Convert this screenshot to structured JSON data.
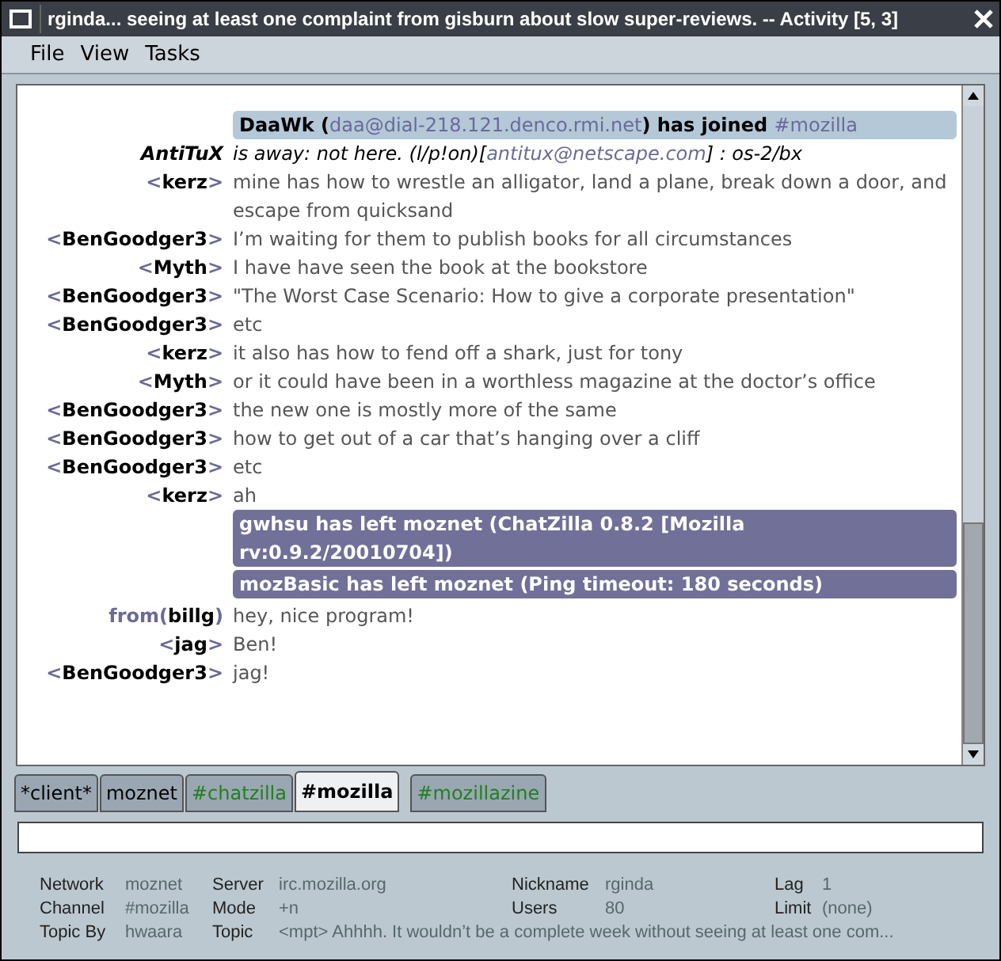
{
  "window": {
    "title": "rginda... seeing at least one complaint from gisburn about slow super-reviews. -- Activity [5, 3]"
  },
  "menu": [
    "File",
    "View",
    "Tasks"
  ],
  "messages": [
    {
      "kind": "join",
      "before": "DaaWk (",
      "host": "daa@dial-218.121.denco.rmi.net",
      "after": ") has joined ",
      "channel": "#mozilla"
    },
    {
      "kind": "away",
      "nick": "AntiTuX",
      "before": "is away: not here. (l/p!on)[",
      "email": "antitux@netscape.com",
      "after": "] : os-2/bx"
    },
    {
      "kind": "msg",
      "open": "<",
      "nick": "kerz",
      "close": ">",
      "text": "mine has how to wrestle an alligator, land a plane, break down a door, and escape from quicksand"
    },
    {
      "kind": "msg",
      "open": "<",
      "nick": "BenGoodger3",
      "close": ">",
      "text": "I’m waiting for them to publish books for all circumstances"
    },
    {
      "kind": "msg",
      "open": "<",
      "nick": "Myth",
      "close": ">",
      "text": "I have have seen the book at the bookstore"
    },
    {
      "kind": "msg",
      "open": "<",
      "nick": "BenGoodger3",
      "close": ">",
      "text": "\"The Worst Case Scenario: How to give a corporate presentation\""
    },
    {
      "kind": "msg",
      "open": "<",
      "nick": "BenGoodger3",
      "close": ">",
      "text": "etc"
    },
    {
      "kind": "msg",
      "open": "<",
      "nick": "kerz",
      "close": ">",
      "text": "it also has how to fend off a shark, just for tony"
    },
    {
      "kind": "msg",
      "open": "<",
      "nick": "Myth",
      "close": ">",
      "text": "or it could have been in a worthless magazine at the doctor’s office"
    },
    {
      "kind": "msg",
      "open": "<",
      "nick": "BenGoodger3",
      "close": ">",
      "text": "the new one is mostly more of the same"
    },
    {
      "kind": "msg",
      "open": "<",
      "nick": "BenGoodger3",
      "close": ">",
      "text": "how to get out of a car that’s hanging over a cliff"
    },
    {
      "kind": "msg",
      "open": "<",
      "nick": "BenGoodger3",
      "close": ">",
      "text": "etc"
    },
    {
      "kind": "msg",
      "open": "<",
      "nick": "kerz",
      "close": ">",
      "text": "ah"
    },
    {
      "kind": "part",
      "text": "gwhsu has left moznet (ChatZilla 0.8.2 [Mozilla rv:0.9.2/20010704])"
    },
    {
      "kind": "part",
      "text": "mozBasic has left moznet (Ping timeout: 180 seconds)"
    },
    {
      "kind": "msg",
      "open": "from(",
      "nick": "billg",
      "close": ")",
      "text": "hey, nice program!"
    },
    {
      "kind": "msg",
      "open": "<",
      "nick": "jag",
      "close": ">",
      "text": "Ben!"
    },
    {
      "kind": "msg",
      "open": "<",
      "nick": "BenGoodger3",
      "close": ">",
      "text": "jag!"
    }
  ],
  "tabs": [
    {
      "label": "*client*",
      "selected": false,
      "activity": false
    },
    {
      "label": "moznet",
      "selected": false,
      "activity": false
    },
    {
      "label": "#chatzilla",
      "selected": false,
      "activity": true
    },
    {
      "label": "#mozilla",
      "selected": true,
      "activity": false
    },
    {
      "label": "#mozillazine",
      "selected": false,
      "activity": true
    }
  ],
  "status": [
    {
      "label": "Network",
      "value": "moznet"
    },
    {
      "label": "Server",
      "value": "irc.mozilla.org"
    },
    {
      "label": "Nickname",
      "value": "rginda"
    },
    {
      "label": "Lag",
      "value": "1"
    },
    {
      "label": "Channel",
      "value": "#mozilla"
    },
    {
      "label": "Mode",
      "value": "+n"
    },
    {
      "label": "Users",
      "value": "80"
    },
    {
      "label": "Limit",
      "value": "(none)"
    },
    {
      "label": "Topic By",
      "value": "hwaara"
    },
    {
      "label": "Topic",
      "value": "<mpt> Ahhhh. It wouldn’t be a complete week without seeing at least one com..."
    }
  ]
}
